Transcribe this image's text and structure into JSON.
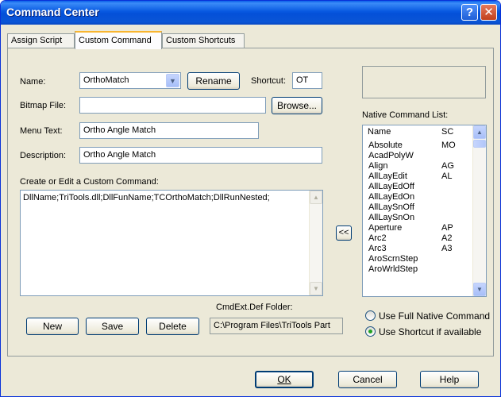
{
  "window": {
    "title": "Command Center",
    "help_glyph": "?",
    "close_glyph": "✕"
  },
  "tabs": [
    {
      "label": "Assign Script",
      "active": false
    },
    {
      "label": "Custom Command",
      "active": true
    },
    {
      "label": "Custom Shortcuts",
      "active": false
    }
  ],
  "form": {
    "name_label": "Name:",
    "name_value": "OrthoMatch",
    "rename_label": "Rename",
    "shortcut_label": "Shortcut:",
    "shortcut_value": "OT",
    "bitmap_label": "Bitmap File:",
    "bitmap_value": "",
    "browse_label": "Browse...",
    "menu_text_label": "Menu Text:",
    "menu_text_value": "Ortho Angle Match",
    "description_label": "Description:",
    "description_value": "Ortho Angle Match",
    "editor_label": "Create or Edit a Custom Command:",
    "editor_value": "DllName;TriTools.dll;DllFunName;TCOrthoMatch;DllRunNested;"
  },
  "buttons": {
    "new": "New",
    "save": "Save",
    "delete": "Delete",
    "transfer": "<<",
    "ok": "OK",
    "cancel": "Cancel",
    "help": "Help"
  },
  "cmdext": {
    "label": "CmdExt.Def Folder:",
    "value": "C:\\Program Files\\TriTools Part"
  },
  "native_list": {
    "label": "Native Command List:",
    "col_name": "Name",
    "col_sc": "SC",
    "rows": [
      {
        "name": "Absolute",
        "sc": "MO"
      },
      {
        "name": "AcadPolyW",
        "sc": ""
      },
      {
        "name": "Align",
        "sc": "AG"
      },
      {
        "name": "AllLayEdit",
        "sc": "AL"
      },
      {
        "name": "AllLayEdOff",
        "sc": ""
      },
      {
        "name": "AllLayEdOn",
        "sc": ""
      },
      {
        "name": "AllLaySnOff",
        "sc": ""
      },
      {
        "name": "AllLaySnOn",
        "sc": ""
      },
      {
        "name": "Aperture",
        "sc": "AP"
      },
      {
        "name": "Arc2",
        "sc": "A2"
      },
      {
        "name": "Arc3",
        "sc": "A3"
      },
      {
        "name": "AroScrnStep",
        "sc": ""
      },
      {
        "name": "AroWrldStep",
        "sc": ""
      }
    ]
  },
  "options": {
    "full_native": "Use Full Native Command",
    "shortcut_if_available": "Use Shortcut if available",
    "selected": "shortcut_if_available"
  },
  "colors": {
    "titlebar": "#0a5ee8",
    "dialog_bg": "#ece9d8",
    "tab_active_accent": "#f8b530"
  }
}
